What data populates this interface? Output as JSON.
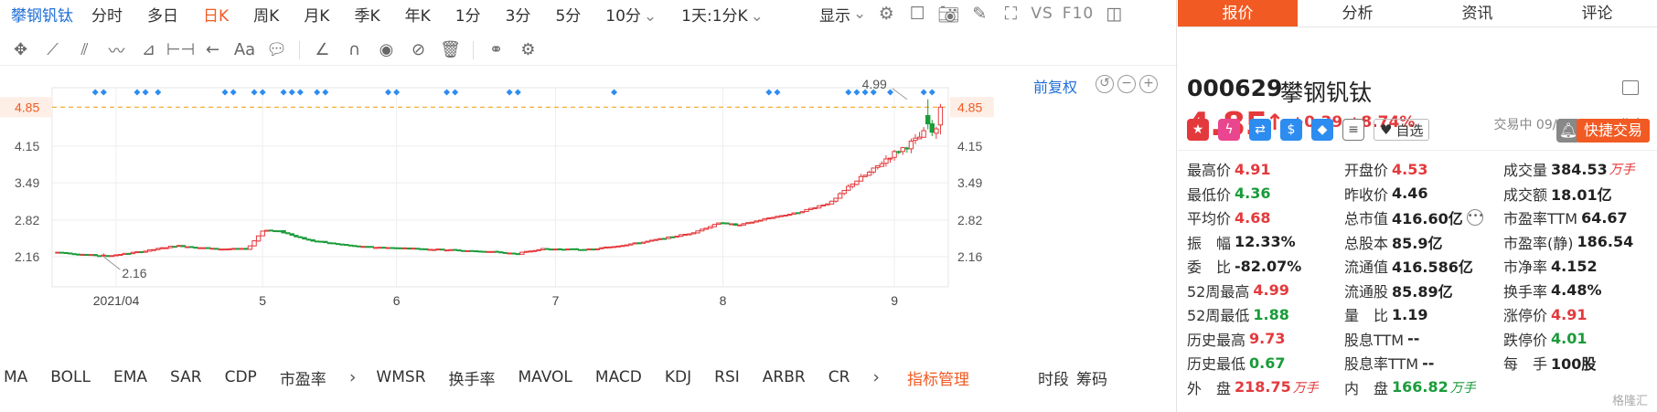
{
  "periods": {
    "stock_name": "攀钢钒钛",
    "items": [
      "分时",
      "多日",
      "日K",
      "周K",
      "月K",
      "季K",
      "年K",
      "1分",
      "3分",
      "5分",
      "10分"
    ],
    "active_index": 2,
    "dropdown": "1天:1分K",
    "display": "显示",
    "vs": "VS",
    "f10": "F10"
  },
  "chart_toolbar": {
    "text_tool": "Aa"
  },
  "chart": {
    "adjust_mode": "前复权",
    "current_price_label": "4.85",
    "high_label": "4.99",
    "low_label": "2.16",
    "y_ticks": [
      "4.85",
      "4.15",
      "3.49",
      "2.82",
      "2.16"
    ],
    "x_labels": [
      "2021/04",
      "5",
      "6",
      "7",
      "8",
      "9"
    ]
  },
  "chart_data": {
    "type": "candlestick",
    "y_ticks": [
      4.85,
      4.15,
      3.49,
      2.82,
      2.16
    ],
    "x_ticks": [
      {
        "index": 14,
        "label": "2021/04"
      },
      {
        "index": 49,
        "label": "5"
      },
      {
        "index": 81,
        "label": "6"
      },
      {
        "index": 119,
        "label": "7"
      },
      {
        "index": 159,
        "label": "8"
      },
      {
        "index": 200,
        "label": "9"
      }
    ],
    "annotations": [
      {
        "label": "4.99",
        "value": 4.99,
        "index": 203
      },
      {
        "label": "2.16",
        "value": 2.16,
        "index": 11
      }
    ],
    "reference_line": 4.85,
    "marker_indices": [
      9,
      11,
      19,
      21,
      24,
      40,
      42,
      47,
      49,
      54,
      56,
      58,
      62,
      64,
      79,
      81,
      93,
      95,
      108,
      110,
      133,
      170,
      172,
      189,
      191,
      193,
      195,
      199,
      207,
      209
    ]
  },
  "indicators": {
    "items": [
      "MA",
      "BOLL",
      "EMA",
      "SAR",
      "CDP",
      "市盈率",
      "WMSR",
      "换手率",
      "MAVOL",
      "MACD",
      "KDJ",
      "RSI",
      "ARBR",
      "CR"
    ],
    "manage": "指标管理",
    "period_label": "时段",
    "chips_label": "筹码"
  },
  "right_panel": {
    "tabs": [
      "报价",
      "分析",
      "资讯",
      "评论"
    ],
    "active_tab": 0,
    "code": "000629",
    "name": "攀钢钒钛",
    "price": "4.85",
    "change": "+0.39",
    "change_pct": "+8.74%",
    "status_time": "交易中 09/06 14:02(北京)",
    "watchlist": "自选",
    "quick_trade": "快捷交易",
    "watermark": "格隆汇",
    "quote": [
      [
        {
          "label": "最高价",
          "value": "4.91",
          "color": "red"
        },
        {
          "label": "开盘价",
          "value": "4.53",
          "color": "red"
        },
        {
          "label": "成交量",
          "value": "384.53",
          "unit": "万手",
          "color": "dark"
        }
      ],
      [
        {
          "label": "最低价",
          "value": "4.36",
          "color": "green"
        },
        {
          "label": "昨收价",
          "value": "4.46",
          "color": "dark"
        },
        {
          "label": "成交额",
          "value": "18.01亿",
          "color": "dark"
        }
      ],
      [
        {
          "label": "平均价",
          "value": "4.68",
          "color": "red"
        },
        {
          "label": "总市值",
          "value": "416.60亿",
          "color": "dark"
        },
        {
          "label": "市盈率TTM",
          "value": "64.67",
          "color": "dark"
        }
      ],
      [
        {
          "label": "振　幅",
          "value": "12.33%",
          "color": "dark"
        },
        {
          "label": "总股本",
          "value": "85.9亿",
          "color": "dark"
        },
        {
          "label": "市盈率(静)",
          "value": "186.54",
          "color": "dark"
        }
      ],
      [
        {
          "label": "委　比",
          "value": "-82.07%",
          "color": "dark"
        },
        {
          "label": "流通值",
          "value": "416.586亿",
          "color": "dark"
        },
        {
          "label": "市净率",
          "value": "4.152",
          "color": "dark"
        }
      ],
      [
        {
          "label": "52周最高",
          "value": "4.99",
          "color": "red"
        },
        {
          "label": "流通股",
          "value": "85.89亿",
          "color": "dark"
        },
        {
          "label": "换手率",
          "value": "4.48%",
          "color": "dark"
        }
      ],
      [
        {
          "label": "52周最低",
          "value": "1.88",
          "color": "green"
        },
        {
          "label": "量　比",
          "value": "1.19",
          "color": "dark"
        },
        {
          "label": "涨停价",
          "value": "4.91",
          "color": "red"
        }
      ],
      [
        {
          "label": "历史最高",
          "value": "9.73",
          "color": "red"
        },
        {
          "label": "股息TTM",
          "value": "--",
          "color": "dark"
        },
        {
          "label": "跌停价",
          "value": "4.01",
          "color": "green"
        }
      ],
      [
        {
          "label": "历史最低",
          "value": "0.67",
          "color": "green"
        },
        {
          "label": "股息率TTM",
          "value": "--",
          "color": "dark"
        },
        {
          "label": "每　手",
          "value": "100股",
          "color": "dark"
        }
      ],
      [
        {
          "label": "外　盘",
          "value": "218.75",
          "unit": "万手",
          "color": "red"
        },
        {
          "label": "内　盘",
          "value": "166.82",
          "unit": "万手",
          "color": "green"
        },
        null
      ]
    ]
  }
}
